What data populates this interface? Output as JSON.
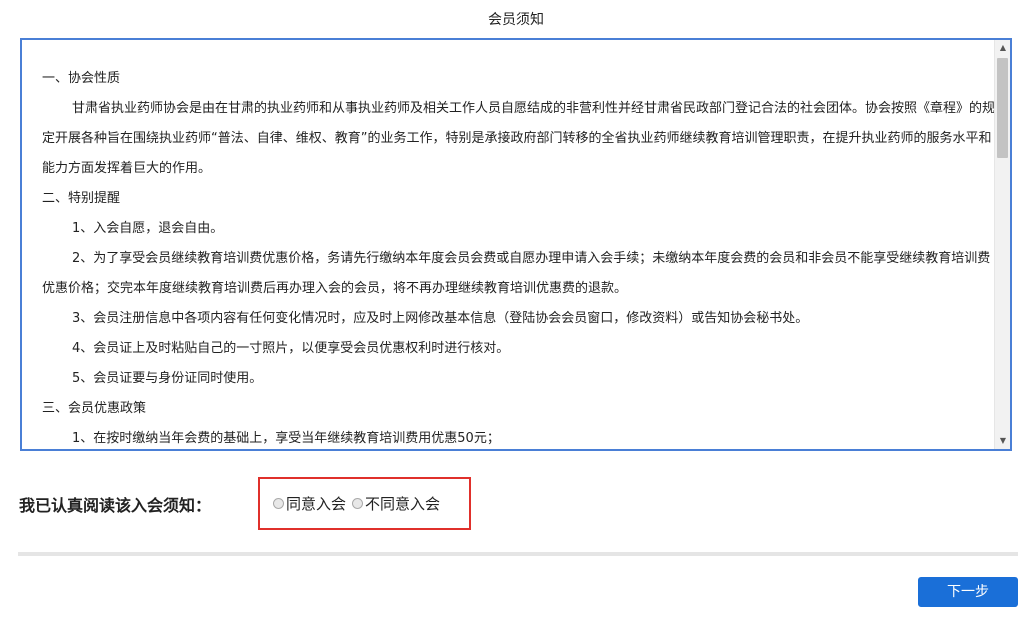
{
  "page_title": "会员须知",
  "notice": {
    "lines": [
      {
        "type": "heading",
        "text": "一、协会性质"
      },
      {
        "type": "para",
        "text": "甘肃省执业药师协会是由在甘肃的执业药师和从事执业药师及相关工作人员自愿结成的非营利性并经甘肃省民政部门登记合法的社会团体。协会按照《章程》的规定开展各种旨在围绕执业药师“普法、自律、维权、教育”的业务工作，特别是承接政府部门转移的全省执业药师继续教育培训管理职责，在提升执业药师的服务水平和能力方面发挥着巨大的作用。"
      },
      {
        "type": "heading",
        "text": "二、特别提醒"
      },
      {
        "type": "item",
        "text": "1、入会自愿，退会自由。"
      },
      {
        "type": "para",
        "text": "2、为了享受会员继续教育培训费优惠价格，务请先行缴纳本年度会员会费或自愿办理申请入会手续；未缴纳本年度会费的会员和非会员不能享受继续教育培训费优惠价格；交完本年度继续教育培训费后再办理入会的会员，将不再办理继续教育培训优惠费的退款。"
      },
      {
        "type": "item",
        "text": "3、会员注册信息中各项内容有任何变化情况时，应及时上网修改基本信息（登陆协会会员窗口，修改资料）或告知协会秘书处。"
      },
      {
        "type": "item",
        "text": "4、会员证上及时粘贴自己的一寸照片，以便享受会员优惠权利时进行核对。"
      },
      {
        "type": "item",
        "text": "5、会员证要与身份证同时使用。"
      },
      {
        "type": "heading",
        "text": "三、会员优惠政策"
      },
      {
        "type": "item",
        "text": "1、在按时缴纳当年会费的基础上，享受当年继续教育培训费用优惠50元；"
      }
    ]
  },
  "scrollbar": {
    "up_arrow": "▲",
    "down_arrow": "▼"
  },
  "agreement": {
    "label": "我已认真阅读该入会须知：",
    "options": [
      "同意入会",
      "不同意入会"
    ]
  },
  "next_button": "下一步",
  "colors": {
    "accent": "#1a6fd8",
    "box_border": "#4a7fd6",
    "highlight": "#e0302b"
  }
}
